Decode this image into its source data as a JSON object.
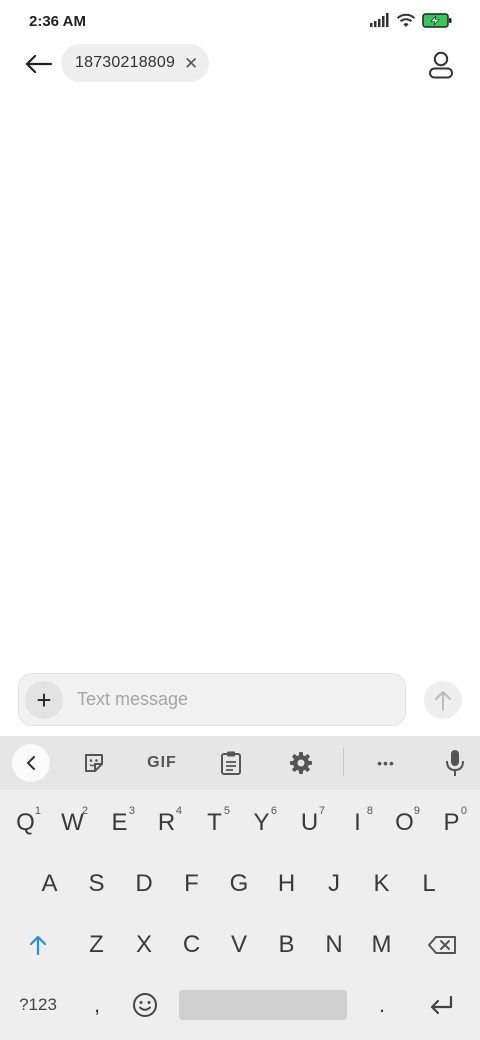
{
  "status_bar": {
    "time": "2:36 AM"
  },
  "header": {
    "recipient": "18730218809",
    "chip_close": "✕"
  },
  "compose": {
    "add_label": "+",
    "placeholder": "Text message"
  },
  "keyboard": {
    "toolbar": {
      "gif": "GIF",
      "more": "•••"
    },
    "row1": [
      {
        "k": "Q",
        "h": "1"
      },
      {
        "k": "W",
        "h": "2"
      },
      {
        "k": "E",
        "h": "3"
      },
      {
        "k": "R",
        "h": "4"
      },
      {
        "k": "T",
        "h": "5"
      },
      {
        "k": "Y",
        "h": "6"
      },
      {
        "k": "U",
        "h": "7"
      },
      {
        "k": "I",
        "h": "8"
      },
      {
        "k": "O",
        "h": "9"
      },
      {
        "k": "P",
        "h": "0"
      }
    ],
    "row2": [
      "A",
      "S",
      "D",
      "F",
      "G",
      "H",
      "J",
      "K",
      "L"
    ],
    "row3": [
      "Z",
      "X",
      "C",
      "V",
      "B",
      "N",
      "M"
    ],
    "bottom": {
      "symbols": "?123",
      "comma": ",",
      "period": "."
    }
  }
}
